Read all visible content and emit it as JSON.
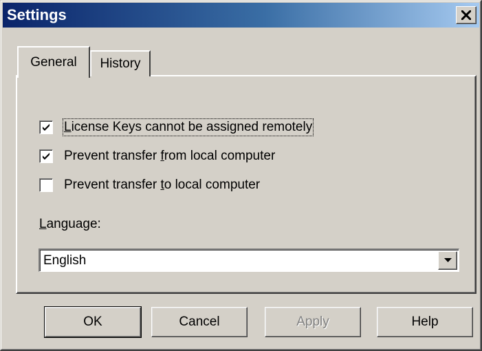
{
  "window": {
    "title": "Settings"
  },
  "tabs": [
    {
      "label": "General",
      "selected": true
    },
    {
      "label": "History",
      "selected": false
    }
  ],
  "general": {
    "options": [
      {
        "label_pre": "",
        "label_u": "L",
        "label_post": "icense Keys cannot be assigned remotely",
        "checked": true
      },
      {
        "label_pre": "Prevent transfer ",
        "label_u": "f",
        "label_post": "rom local computer",
        "checked": true
      },
      {
        "label_pre": "Prevent transfer ",
        "label_u": "t",
        "label_post": "o local computer",
        "checked": false
      }
    ],
    "language": {
      "label_u": "L",
      "label_post": "anguage:",
      "value": "English"
    }
  },
  "buttons": {
    "ok": "OK",
    "cancel": "Cancel",
    "apply": "Apply",
    "help": "Help"
  },
  "icons": {
    "close": "close-icon",
    "check": "checkmark-icon",
    "dropdown": "chevron-down-icon"
  },
  "colors": {
    "face": "#d4d0c8",
    "title_start": "#0a246a",
    "title_end": "#a6caf0"
  }
}
